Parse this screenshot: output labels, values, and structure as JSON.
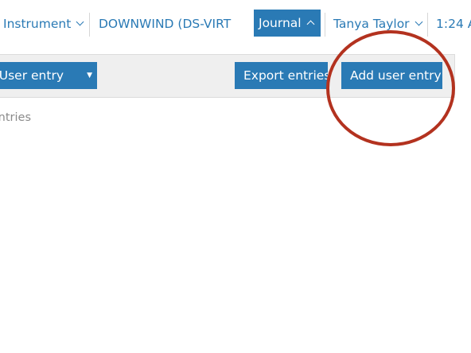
{
  "nav": {
    "instrument": {
      "label": "Instrument",
      "icon": "chevron-down-icon"
    },
    "device": {
      "label": "DOWNWIND (DS-VIRT"
    },
    "journal": {
      "label": "Journal",
      "icon": "chevron-up-icon"
    },
    "user": {
      "label": "Tanya Taylor",
      "icon": "chevron-down-icon"
    },
    "clock": {
      "label": "1:24 A"
    }
  },
  "toolbar": {
    "entry_type_select": {
      "value": "User entry",
      "icon": "caret-down-icon"
    },
    "export_label": "Export entries",
    "add_label": "Add user entry"
  },
  "main": {
    "entries_text": "No entries"
  },
  "colors": {
    "accent": "#2a7ab5",
    "toolbar_bg": "#efefef",
    "annotation_red": "#b3321f",
    "muted_text": "#8a8a8a"
  }
}
